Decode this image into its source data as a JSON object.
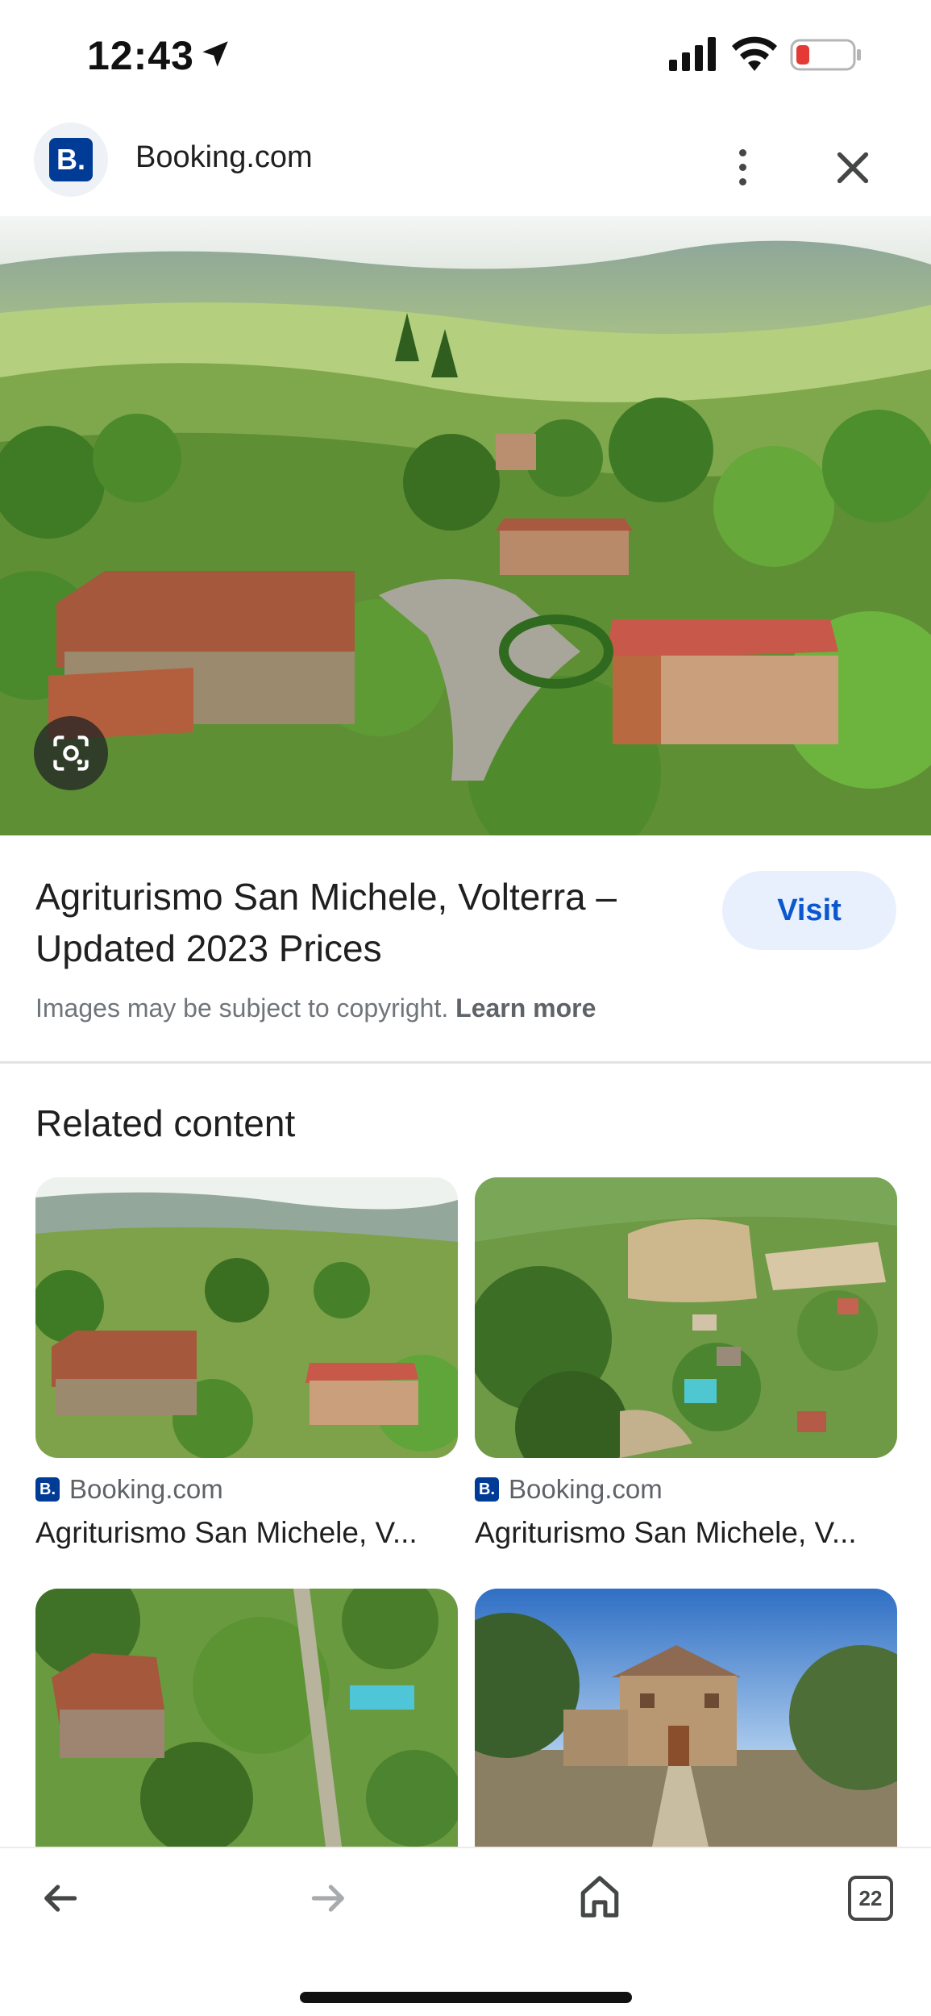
{
  "status_bar": {
    "time": "12:43",
    "icons": [
      "location-arrow-icon",
      "cellular-signal-icon",
      "wifi-icon",
      "battery-low-icon"
    ],
    "battery_color": "#e53935"
  },
  "header": {
    "logo_text": "B.",
    "site_name": "Booking.com",
    "icons": [
      "more-vert-icon",
      "close-icon"
    ]
  },
  "result": {
    "title": "Agriturismo San Michele, Volterra – Updated 2023 Prices",
    "visit_label": "Visit",
    "copyright_text": "Images may be subject to copyright.",
    "learn_more": "Learn more"
  },
  "related": {
    "heading": "Related content",
    "items": [
      {
        "source": "Booking.com",
        "source_logo": "B.",
        "title": "Agriturismo San Michele, V..."
      },
      {
        "source": "Booking.com",
        "source_logo": "B.",
        "title": "Agriturismo San Michele, V..."
      }
    ]
  },
  "bottom_nav": {
    "icons": [
      "back-arrow-icon",
      "forward-arrow-icon",
      "home-icon",
      "tabs-icon"
    ],
    "tab_count": "22"
  },
  "colors": {
    "brand": "#003b95",
    "visit_bg": "#e8f0fe",
    "visit_text": "#0b57d0"
  }
}
